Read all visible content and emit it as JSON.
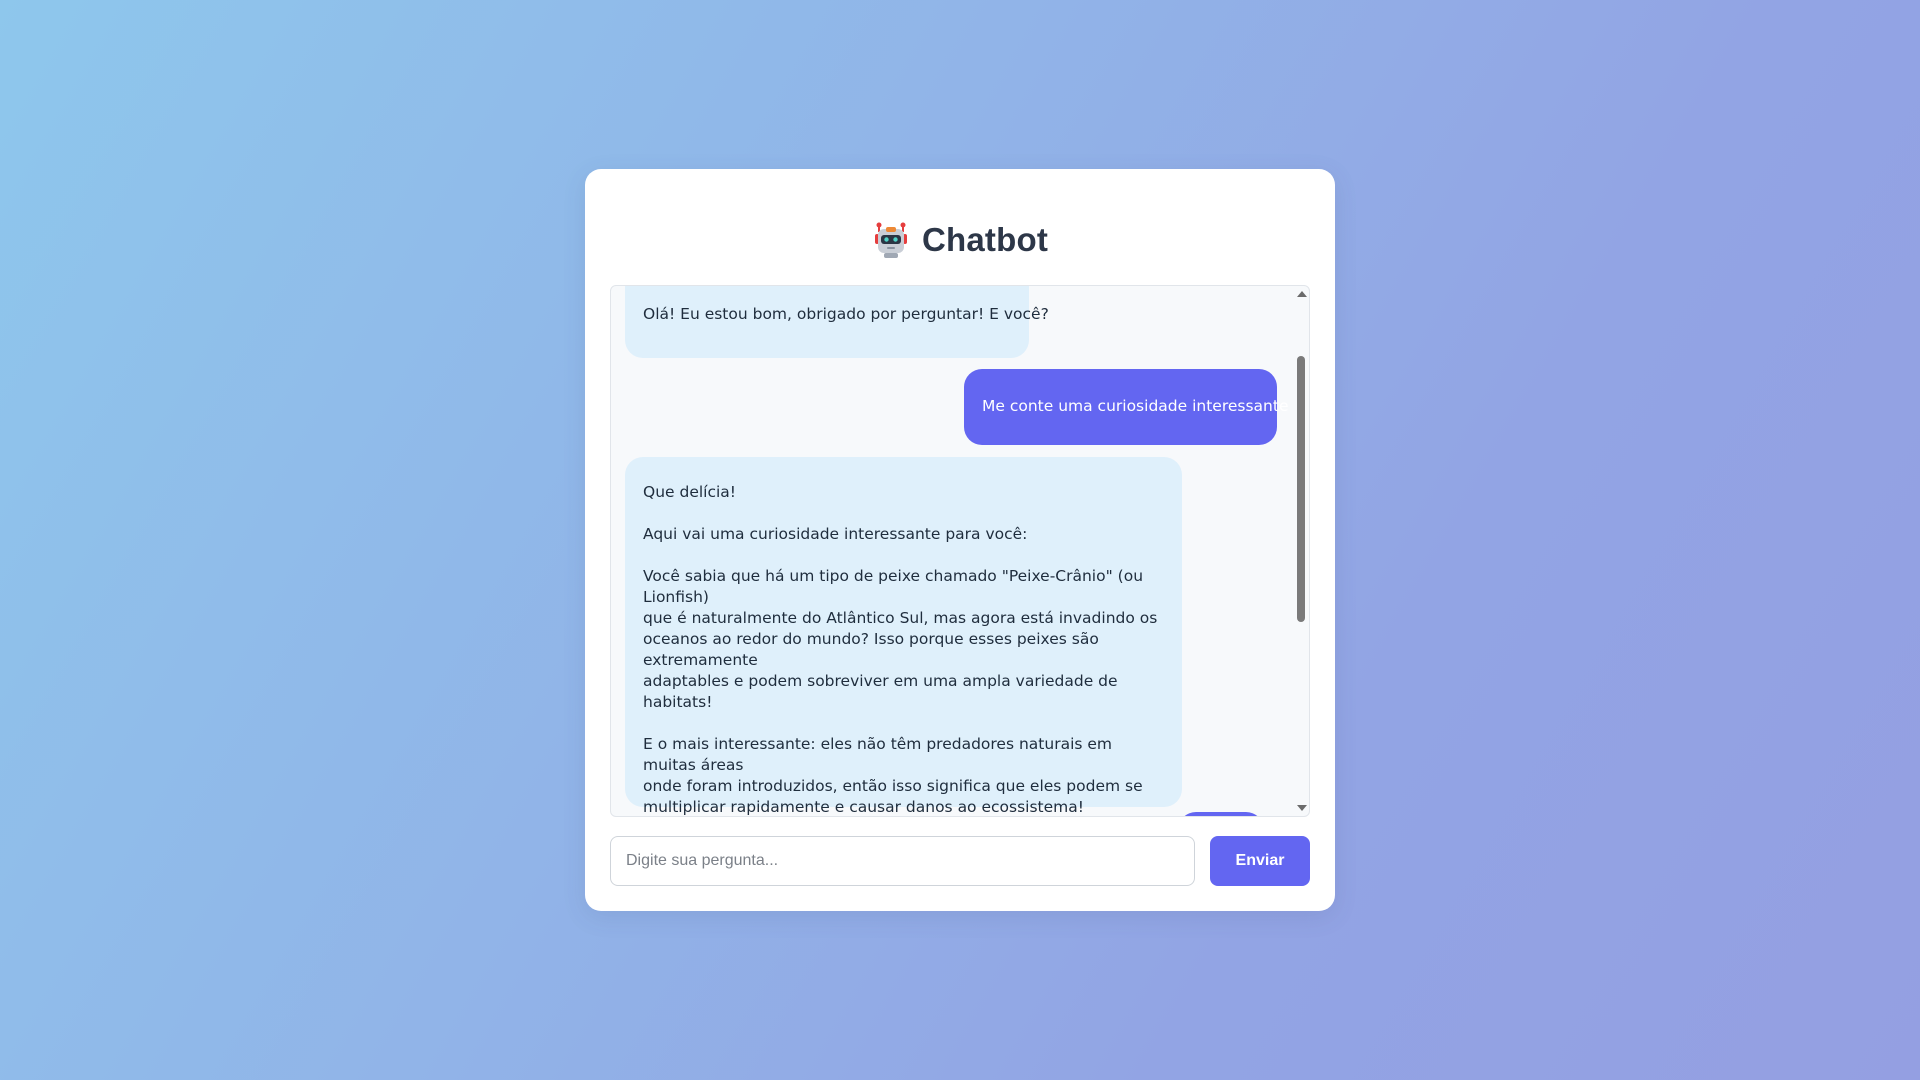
{
  "header": {
    "title": "Chatbot",
    "icon": "robot-icon"
  },
  "chat": {
    "messages": [
      {
        "role": "bot",
        "text": "Olá! Eu estou bom, obrigado por perguntar! E você?"
      },
      {
        "role": "user",
        "text": "Me conte uma curiosidade interessante"
      },
      {
        "role": "bot",
        "text": "Que delícia!\n\nAqui vai uma curiosidade interessante para você:\n\nVocê sabia que há um tipo de peixe chamado \"Peixe-Crânio\" (ou Lionfish)\nque é naturalmente do Atlântico Sul, mas agora está invadindo os\noceanos ao redor do mundo? Isso porque esses peixes são extremamente\nadaptables e podem sobreviver em uma ampla variedade de habitats!\n\nE o mais interessante: eles não têm predadores naturais em muitas áreas\nonde foram introduzidos, então isso significa que eles podem se\nmultiplicar rapidamente e causar danos ao ecossistema!\n\nVocê achou essa curiosidade interessante?"
      }
    ]
  },
  "input": {
    "placeholder": "Digite sua pergunta...",
    "value": ""
  },
  "send_button": {
    "label": "Enviar"
  },
  "colors": {
    "accent": "#6366f1",
    "bot_bubble": "#dff0fb",
    "title_text": "#2d3748"
  }
}
